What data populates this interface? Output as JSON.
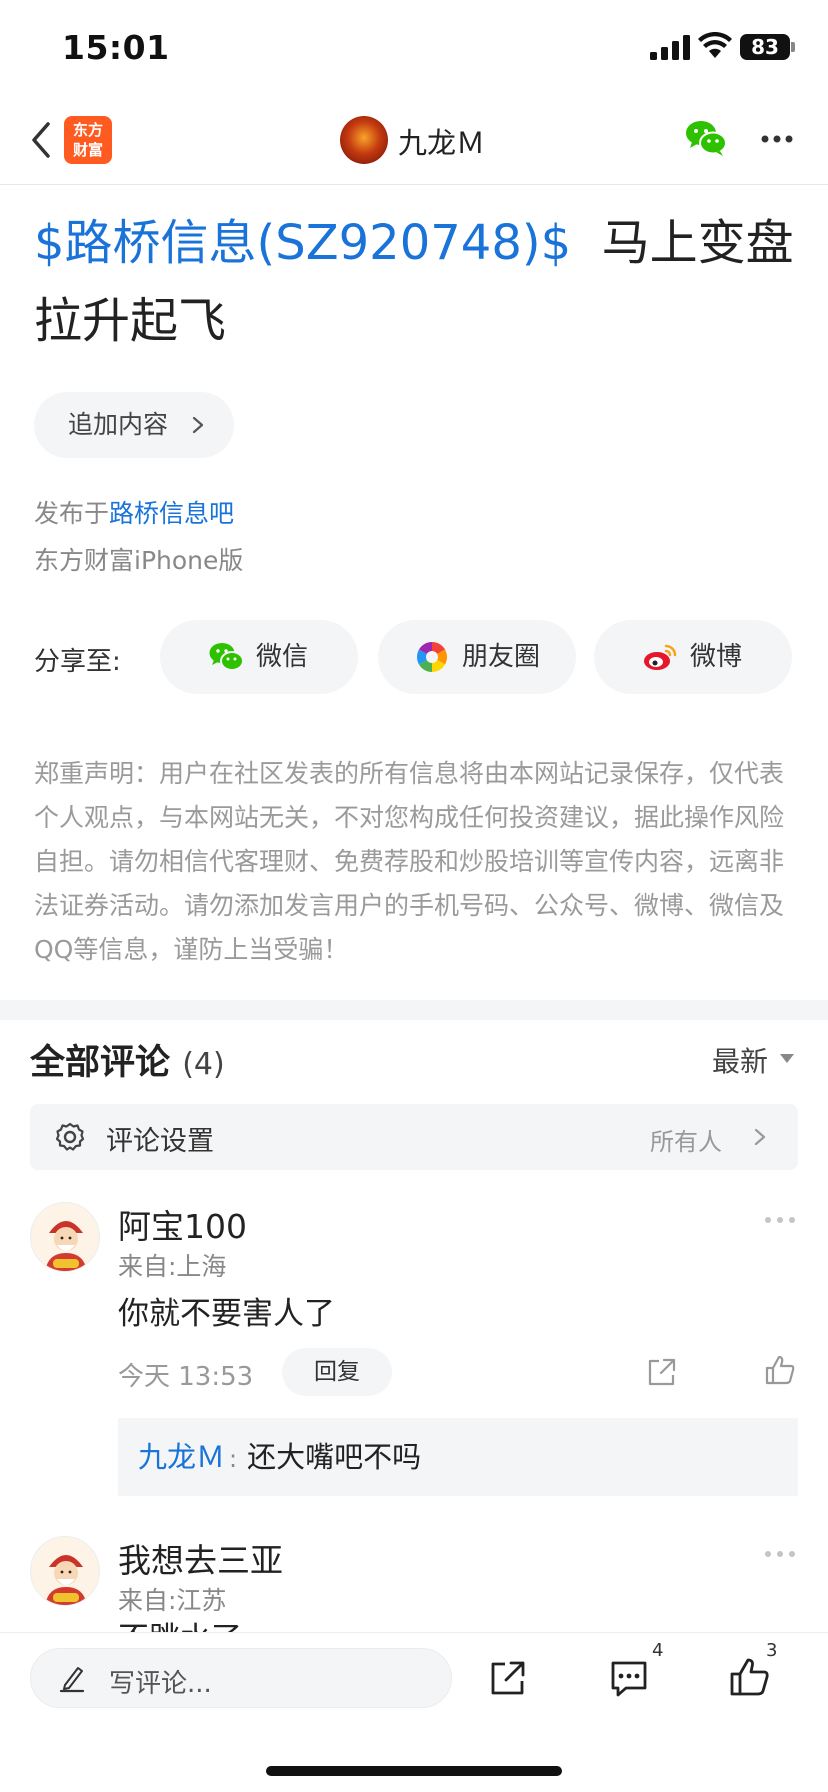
{
  "status_bar": {
    "time": "15:01",
    "battery": "83"
  },
  "nav": {
    "title": "九龙Ｍ",
    "logo_text_line1": "东方",
    "logo_text_line2": "财富"
  },
  "post": {
    "stock_tag": "$路桥信息(SZ920748)$",
    "title_text": "马上变盘拉升起飞",
    "append_label": "追加内容",
    "published_prefix": "发布于",
    "published_forum": "路桥信息吧",
    "device": "东方财富iPhone版"
  },
  "share": {
    "label": "分享至:",
    "wechat": "微信",
    "moments": "朋友圈",
    "weibo": "微博"
  },
  "disclaimer": "郑重声明：用户在社区发表的所有信息将由本网站记录保存，仅代表个人观点，与本网站无关，不对您构成任何投资建议，据此操作风险自担。请勿相信代客理财、免费荐股和炒股培训等宣传内容，远离非法证券活动。请勿添加发言用户的手机号码、公众号、微博、微信及QQ等信息，谨防上当受骗！",
  "comments_header": {
    "title": "全部评论",
    "count": "(4)",
    "sort": "最新"
  },
  "comment_settings": {
    "label": "评论设置",
    "value": "所有人"
  },
  "comments": [
    {
      "name": "阿宝100",
      "from": "来自:上海",
      "body": "你就不要害人了",
      "time": "今天 13:53",
      "reply_label": "回复",
      "sub_reply": {
        "author": "九龙Ｍ",
        "sep": ":",
        "text": "还大嘴吧不吗"
      }
    },
    {
      "name": "我想去三亚",
      "from": "来自:江苏",
      "body": "不跳水了"
    }
  ],
  "bottom_bar": {
    "placeholder": "写评论...",
    "comment_count": "4",
    "like_count": "3"
  },
  "colors": {
    "link_blue": "#1a73d9",
    "logo_orange": "#ff5a1f",
    "wechat_green": "#2dc100",
    "weibo_red": "#e6162d"
  }
}
